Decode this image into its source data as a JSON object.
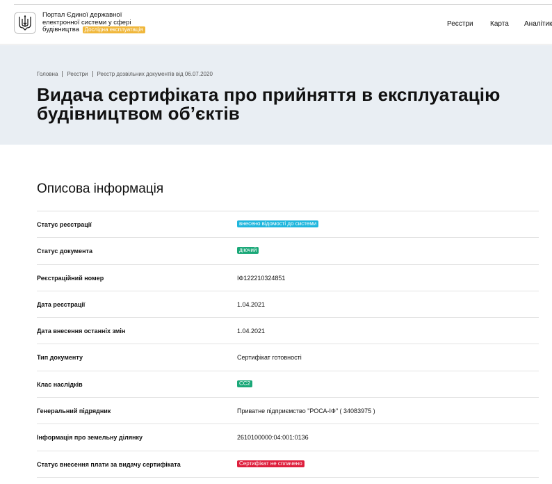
{
  "header": {
    "portal_title": "Портал Єдиної державної електронної системи у сфері будівництва",
    "trial_badge": "Дослідна експлуатація",
    "nav": [
      "Реєстри",
      "Карта",
      "Аналітика"
    ]
  },
  "breadcrumb": [
    "Головна",
    "Реєстри",
    "Реєстр дозвільних документів від 06.07.2020"
  ],
  "page": {
    "title_line1": "Видача сертифіката про прийняття в експлуатацію",
    "title_line2": "будівництвом об’єктів"
  },
  "section": {
    "title": "Описова інформація",
    "rows": [
      {
        "label": "Статус реєстрації",
        "value": "внесено відомості до системи"
      },
      {
        "label": "Статус документа",
        "value": "діючий"
      },
      {
        "label": "Реєстраційний номер",
        "value": "ІФ122210324851"
      },
      {
        "label": "Дата реєстрації",
        "value": "1.04.2021"
      },
      {
        "label": "Дата внесення останніх змін",
        "value": "1.04.2021"
      },
      {
        "label": "Тип документу",
        "value": "Сертифікат готовності"
      },
      {
        "label": "Клас наслідків",
        "value": "СС2"
      },
      {
        "label": "Генеральний підрядник",
        "value": "Приватне підприємство \"РОСА-ІФ\" ( 34083975 )"
      },
      {
        "label": "Інформація про земельну ділянку",
        "value": "2610100000:04:001:0136"
      },
      {
        "label": "Статус внесення плати за видачу сертифіката",
        "value": "Сертифікат не сплачено"
      }
    ]
  },
  "colors": {
    "badge_cyan": "#1fb6dd",
    "badge_green": "#1aa878",
    "badge_red": "#de1f3d",
    "trial_badge": "#f0b73b",
    "hero_bg": "#e9eef3"
  },
  "icons": {
    "logo": "ukraine-trident-icon"
  }
}
